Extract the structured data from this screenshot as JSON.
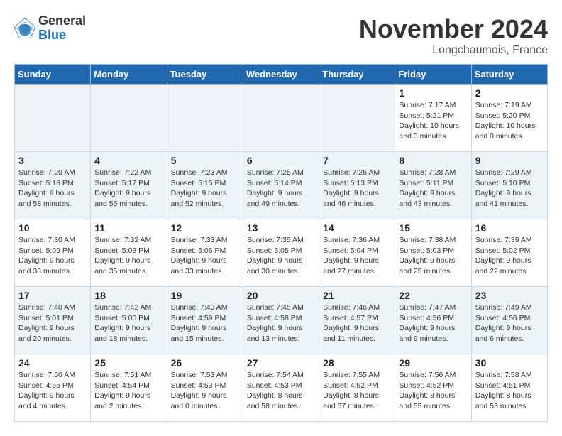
{
  "header": {
    "logo_general": "General",
    "logo_blue": "Blue",
    "month_year": "November 2024",
    "location": "Longchaumois, France"
  },
  "weekdays": [
    "Sunday",
    "Monday",
    "Tuesday",
    "Wednesday",
    "Thursday",
    "Friday",
    "Saturday"
  ],
  "weeks": [
    [
      {
        "day": "",
        "info": ""
      },
      {
        "day": "",
        "info": ""
      },
      {
        "day": "",
        "info": ""
      },
      {
        "day": "",
        "info": ""
      },
      {
        "day": "",
        "info": ""
      },
      {
        "day": "1",
        "info": "Sunrise: 7:17 AM\nSunset: 5:21 PM\nDaylight: 10 hours\nand 3 minutes."
      },
      {
        "day": "2",
        "info": "Sunrise: 7:19 AM\nSunset: 5:20 PM\nDaylight: 10 hours\nand 0 minutes."
      }
    ],
    [
      {
        "day": "3",
        "info": "Sunrise: 7:20 AM\nSunset: 5:18 PM\nDaylight: 9 hours\nand 58 minutes."
      },
      {
        "day": "4",
        "info": "Sunrise: 7:22 AM\nSunset: 5:17 PM\nDaylight: 9 hours\nand 55 minutes."
      },
      {
        "day": "5",
        "info": "Sunrise: 7:23 AM\nSunset: 5:15 PM\nDaylight: 9 hours\nand 52 minutes."
      },
      {
        "day": "6",
        "info": "Sunrise: 7:25 AM\nSunset: 5:14 PM\nDaylight: 9 hours\nand 49 minutes."
      },
      {
        "day": "7",
        "info": "Sunrise: 7:26 AM\nSunset: 5:13 PM\nDaylight: 9 hours\nand 46 minutes."
      },
      {
        "day": "8",
        "info": "Sunrise: 7:28 AM\nSunset: 5:11 PM\nDaylight: 9 hours\nand 43 minutes."
      },
      {
        "day": "9",
        "info": "Sunrise: 7:29 AM\nSunset: 5:10 PM\nDaylight: 9 hours\nand 41 minutes."
      }
    ],
    [
      {
        "day": "10",
        "info": "Sunrise: 7:30 AM\nSunset: 5:09 PM\nDaylight: 9 hours\nand 38 minutes."
      },
      {
        "day": "11",
        "info": "Sunrise: 7:32 AM\nSunset: 5:08 PM\nDaylight: 9 hours\nand 35 minutes."
      },
      {
        "day": "12",
        "info": "Sunrise: 7:33 AM\nSunset: 5:06 PM\nDaylight: 9 hours\nand 33 minutes."
      },
      {
        "day": "13",
        "info": "Sunrise: 7:35 AM\nSunset: 5:05 PM\nDaylight: 9 hours\nand 30 minutes."
      },
      {
        "day": "14",
        "info": "Sunrise: 7:36 AM\nSunset: 5:04 PM\nDaylight: 9 hours\nand 27 minutes."
      },
      {
        "day": "15",
        "info": "Sunrise: 7:38 AM\nSunset: 5:03 PM\nDaylight: 9 hours\nand 25 minutes."
      },
      {
        "day": "16",
        "info": "Sunrise: 7:39 AM\nSunset: 5:02 PM\nDaylight: 9 hours\nand 22 minutes."
      }
    ],
    [
      {
        "day": "17",
        "info": "Sunrise: 7:40 AM\nSunset: 5:01 PM\nDaylight: 9 hours\nand 20 minutes."
      },
      {
        "day": "18",
        "info": "Sunrise: 7:42 AM\nSunset: 5:00 PM\nDaylight: 9 hours\nand 18 minutes."
      },
      {
        "day": "19",
        "info": "Sunrise: 7:43 AM\nSunset: 4:59 PM\nDaylight: 9 hours\nand 15 minutes."
      },
      {
        "day": "20",
        "info": "Sunrise: 7:45 AM\nSunset: 4:58 PM\nDaylight: 9 hours\nand 13 minutes."
      },
      {
        "day": "21",
        "info": "Sunrise: 7:46 AM\nSunset: 4:57 PM\nDaylight: 9 hours\nand 11 minutes."
      },
      {
        "day": "22",
        "info": "Sunrise: 7:47 AM\nSunset: 4:56 PM\nDaylight: 9 hours\nand 9 minutes."
      },
      {
        "day": "23",
        "info": "Sunrise: 7:49 AM\nSunset: 4:56 PM\nDaylight: 9 hours\nand 6 minutes."
      }
    ],
    [
      {
        "day": "24",
        "info": "Sunrise: 7:50 AM\nSunset: 4:55 PM\nDaylight: 9 hours\nand 4 minutes."
      },
      {
        "day": "25",
        "info": "Sunrise: 7:51 AM\nSunset: 4:54 PM\nDaylight: 9 hours\nand 2 minutes."
      },
      {
        "day": "26",
        "info": "Sunrise: 7:53 AM\nSunset: 4:53 PM\nDaylight: 9 hours\nand 0 minutes."
      },
      {
        "day": "27",
        "info": "Sunrise: 7:54 AM\nSunset: 4:53 PM\nDaylight: 8 hours\nand 58 minutes."
      },
      {
        "day": "28",
        "info": "Sunrise: 7:55 AM\nSunset: 4:52 PM\nDaylight: 8 hours\nand 57 minutes."
      },
      {
        "day": "29",
        "info": "Sunrise: 7:56 AM\nSunset: 4:52 PM\nDaylight: 8 hours\nand 55 minutes."
      },
      {
        "day": "30",
        "info": "Sunrise: 7:58 AM\nSunset: 4:51 PM\nDaylight: 8 hours\nand 53 minutes."
      }
    ]
  ]
}
